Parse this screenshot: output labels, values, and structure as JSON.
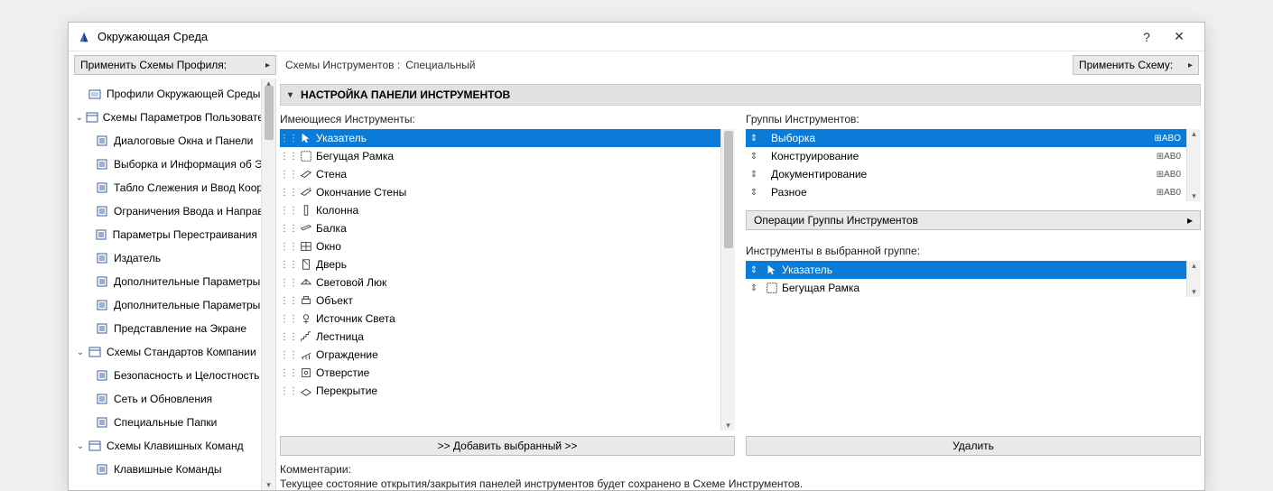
{
  "window": {
    "title": "Окружающая Среда"
  },
  "toolbar": {
    "apply_profile": "Применить Схемы Профиля:",
    "scheme_label": "Схемы Инструментов :",
    "scheme_value": "Специальный",
    "apply_scheme": "Применить Схему:"
  },
  "sidebar": {
    "items": [
      {
        "level": "root",
        "label": "Профили Окружающей Среды"
      },
      {
        "level": "level1",
        "label": "Схемы Параметров Пользователя",
        "expanded": true
      },
      {
        "level": "level2",
        "label": "Диалоговые Окна и Панели"
      },
      {
        "level": "level2",
        "label": "Выборка и Информация об Эле"
      },
      {
        "level": "level2",
        "label": "Табло Слежения и Ввод Коорди"
      },
      {
        "level": "level2",
        "label": "Ограничения Ввода и Направл"
      },
      {
        "level": "level2",
        "label": "Параметры Перестраивания Мо"
      },
      {
        "level": "level2",
        "label": "Издатель"
      },
      {
        "level": "level2",
        "label": "Дополнительные Параметры"
      },
      {
        "level": "level2",
        "label": "Дополнительные Параметры О"
      },
      {
        "level": "level2",
        "label": "Представление на Экране"
      },
      {
        "level": "level1",
        "label": "Схемы Стандартов Компании",
        "expanded": true
      },
      {
        "level": "level2",
        "label": "Безопасность и Целостность да"
      },
      {
        "level": "level2",
        "label": "Сеть и Обновления"
      },
      {
        "level": "level2",
        "label": "Специальные Папки"
      },
      {
        "level": "level1",
        "label": "Схемы Клавишных Команд",
        "expanded": true
      },
      {
        "level": "level2",
        "label": "Клавишные Команды"
      }
    ]
  },
  "main": {
    "section_header": "НАСТРОЙКА ПАНЕЛИ ИНСТРУМЕНТОВ",
    "available_label": "Имеющиеся Инструменты:",
    "groups_label": "Группы Инструментов:",
    "group_ops": "Операции Группы Инструментов",
    "selected_label": "Инструменты в выбранной группе:",
    "add_button": ">> Добавить выбранный >>",
    "remove_button": "Удалить",
    "comments_label": "Комментарии:",
    "comments_text": "Текущее состояние открытия/закрытия панелей инструментов будет сохранено в Схеме Инструментов.",
    "available": [
      {
        "name": "Указатель",
        "selected": true,
        "icon": "pointer"
      },
      {
        "name": "Бегущая Рамка",
        "icon": "marquee"
      },
      {
        "name": "Стена",
        "icon": "wall"
      },
      {
        "name": "Окончание Стены",
        "icon": "wallend"
      },
      {
        "name": "Колонна",
        "icon": "column"
      },
      {
        "name": "Балка",
        "icon": "beam"
      },
      {
        "name": "Окно",
        "icon": "window"
      },
      {
        "name": "Дверь",
        "icon": "door"
      },
      {
        "name": "Световой Люк",
        "icon": "skylight"
      },
      {
        "name": "Объект",
        "icon": "object"
      },
      {
        "name": "Источник Света",
        "icon": "light"
      },
      {
        "name": "Лестница",
        "icon": "stair"
      },
      {
        "name": "Ограждение",
        "icon": "railing"
      },
      {
        "name": "Отверстие",
        "icon": "opening"
      },
      {
        "name": "Перекрытие",
        "icon": "slab"
      }
    ],
    "groups": [
      {
        "name": "Выборка",
        "selected": true,
        "meta": "ABО"
      },
      {
        "name": "Конструирование",
        "meta": "АВ0"
      },
      {
        "name": "Документирование",
        "meta": "АВ0"
      },
      {
        "name": "Разное",
        "meta": "АВ0"
      }
    ],
    "selected_tools": [
      {
        "name": "Указатель",
        "selected": true,
        "icon": "pointer"
      },
      {
        "name": "Бегущая Рамка",
        "icon": "marquee"
      }
    ]
  }
}
